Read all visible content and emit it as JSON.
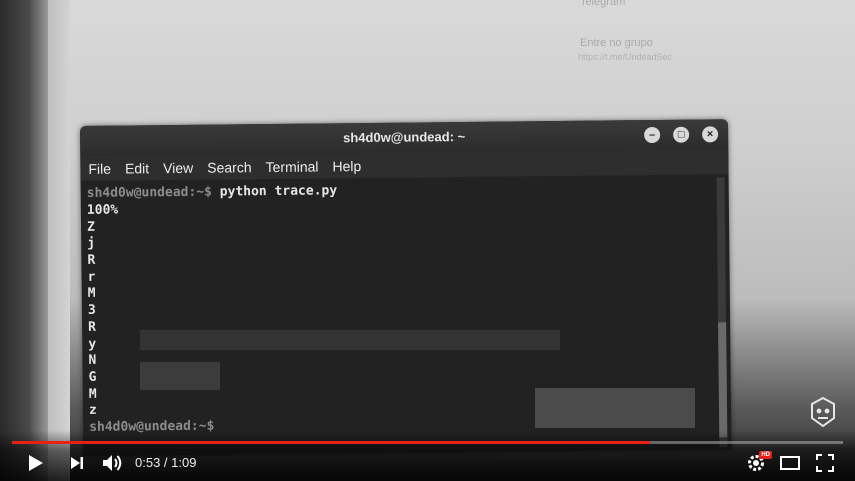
{
  "background": {
    "telegram_heading": "Telegram",
    "join_text": "Entre no grupo",
    "group_link": "https://t.me/UndeadSec"
  },
  "terminal": {
    "title": "sh4d0w@undead: ~",
    "window_buttons": [
      "–",
      "□",
      "×"
    ],
    "menu": [
      "File",
      "Edit",
      "View",
      "Search",
      "Terminal",
      "Help"
    ],
    "prompt_user": "sh4d0w@undead",
    "prompt_path": ":~$",
    "command": " python trace.py",
    "output": [
      "100%",
      "Z",
      "j",
      "R",
      "r",
      "M",
      "3",
      "R",
      "y",
      "N",
      "G",
      "M",
      "z"
    ],
    "final_prompt": "sh4d0w@undead:~$"
  },
  "player": {
    "current_time": "0:53",
    "separator": " / ",
    "duration": "1:09",
    "progress": 0.768,
    "hd_badge": "HD",
    "colors": {
      "progress": "#e62117",
      "accent": "#e62117"
    },
    "icons": [
      "play-icon",
      "next-icon",
      "volume-icon",
      "settings-icon",
      "theater-mode-icon",
      "fullscreen-icon",
      "channel-logo-icon"
    ]
  }
}
